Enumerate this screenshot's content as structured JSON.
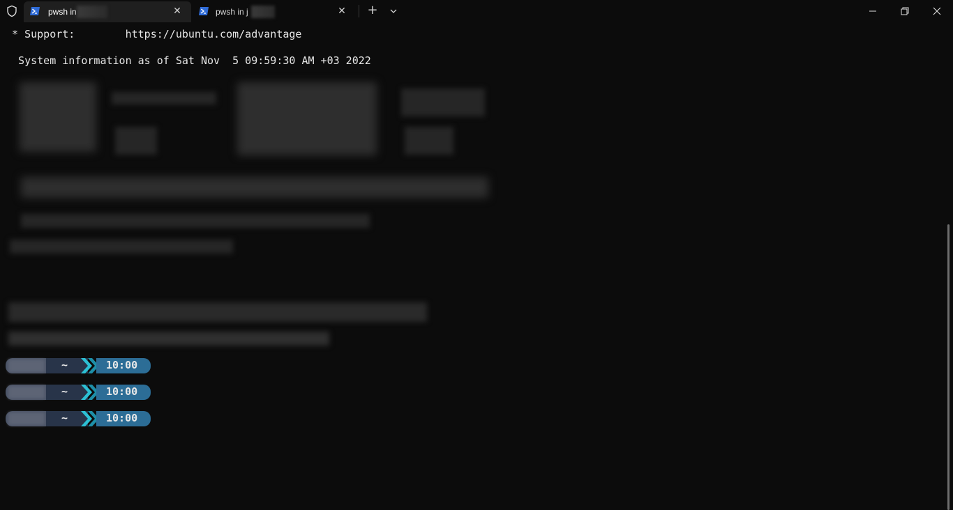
{
  "tabs": [
    {
      "label": "pwsh in",
      "active": true
    },
    {
      "label": "pwsh in j",
      "active": false
    }
  ],
  "icons": {
    "shield": "shield-icon",
    "tab_icon": "powershell-icon",
    "close": "close-icon",
    "new_tab": "plus-icon",
    "dropdown": "chevron-down-icon",
    "minimize": "minimize-icon",
    "maximize": "restore-icon",
    "window_close": "close-window-icon"
  },
  "terminal": {
    "support_line": " * Support:        https://ubuntu.com/advantage",
    "sysinfo_line": "  System information as of Sat Nov  5 09:59:30 AM +03 2022"
  },
  "prompts": [
    {
      "dir": "~",
      "time": "10:00"
    },
    {
      "dir": "~",
      "time": "10:00"
    },
    {
      "dir": "~",
      "time": "10:00"
    }
  ],
  "colors": {
    "background": "#0c0c0c",
    "tab_active": "#1f1f1f",
    "prompt_time_bg": "#2c6d96",
    "prompt_accent": "#21a3b8"
  }
}
